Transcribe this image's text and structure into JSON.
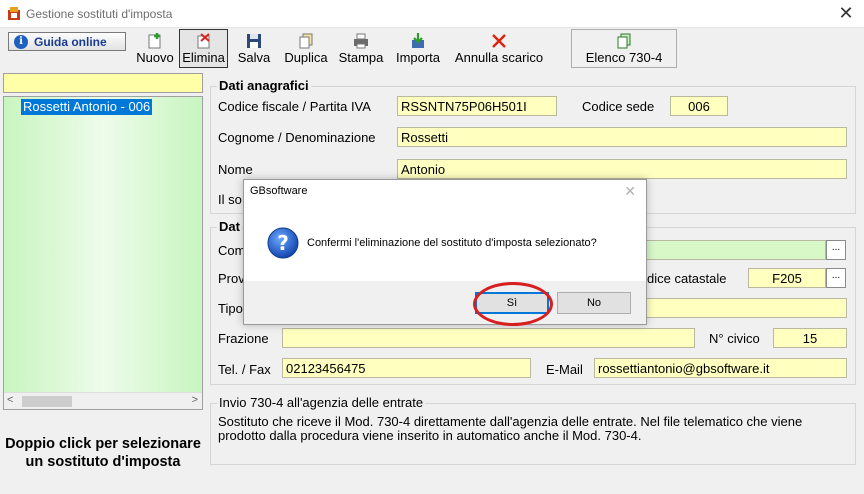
{
  "window": {
    "title": "Gestione sostituti d'imposta"
  },
  "toolbar": {
    "guida": "Guida online",
    "nuovo": "Nuovo",
    "elimina": "Elimina",
    "salva": "Salva",
    "duplica": "Duplica",
    "stampa": "Stampa",
    "importa": "Importa",
    "annulla": "Annulla scarico",
    "elenco": "Elenco 730-4"
  },
  "sidebar": {
    "items": [
      {
        "label": "Rossetti Antonio - 006"
      }
    ],
    "hint": "Doppio click per selezionare un sostituto d'imposta"
  },
  "dati_anagrafici": {
    "legend": "Dati anagrafici",
    "cf_label": "Codice fiscale / Partita IVA",
    "cf_value": "RSSNTN75P06H501I",
    "sede_label": "Codice sede",
    "sede_value": "006",
    "cognome_label": "Cognome / Denominazione",
    "cognome_value": "Rossetti",
    "nome_label": "Nome",
    "nome_value": "Antonio",
    "partial_label": "Il so"
  },
  "second_group": {
    "legend": "Dat",
    "com_label": "Com",
    "prov_label": "Prov",
    "catastale_label": "dice catastale",
    "catastale_value": "F205",
    "tipo_label": "Tipo",
    "frazione_label": "Frazione",
    "frazione_value": "",
    "civico_label": "N° civico",
    "civico_value": "15",
    "tel_label": "Tel. / Fax",
    "tel_value": "02123456475",
    "email_label": "E-Mail",
    "email_value": "rossettiantonio@gbsoftware.it"
  },
  "invio": {
    "legend": "Invio 730-4 all'agenzia delle entrate",
    "text": "Sostituto che riceve il Mod. 730-4 direttamente dall'agenzia delle entrate. Nel file telematico che viene prodotto dalla procedura viene inserito in automatico anche il Mod. 730-4."
  },
  "dialog": {
    "title": "GBsoftware",
    "message": "Confermi l'eliminazione del sostituto d'imposta selezionato?",
    "yes": "Sì",
    "no": "No"
  },
  "colors": {
    "field_yellow": "#ffffc0",
    "list_green": "#c8f5c0",
    "selection": "#0078d7",
    "highlight_ring": "#d81f1f"
  }
}
